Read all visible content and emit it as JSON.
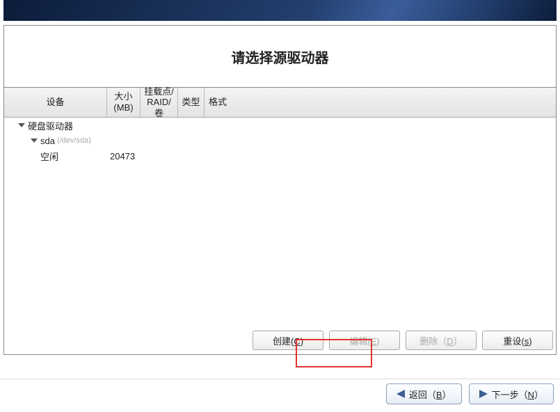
{
  "title": "请选择源驱动器",
  "columns": {
    "device": "设备",
    "size": "大小 (MB)",
    "mount": "挂载点/ RAID/卷",
    "type": "类型",
    "format": "格式"
  },
  "tree": {
    "root_label": "硬盘驱动器",
    "disk": {
      "name": "sda",
      "path": "(/dev/sda)"
    },
    "free": {
      "label": "空闲",
      "size": "20473"
    }
  },
  "actions": {
    "create": "创建(C)",
    "edit": "编辑(E)",
    "delete": "删除（D）",
    "reset": "重设(s)"
  },
  "nav": {
    "back": "返回（B）",
    "next": "下一步（N）"
  }
}
